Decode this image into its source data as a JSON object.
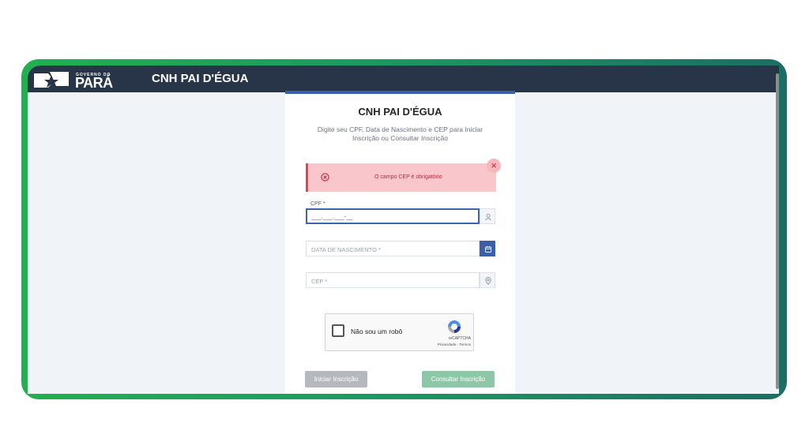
{
  "header": {
    "logo_small": "GOVERNO DO",
    "logo_big": "PARÁ",
    "title": "CNH PAI D'ÉGUA"
  },
  "card": {
    "title": "CNH PAI D'ÉGUA",
    "description": "Digite seu CPF, Data de Nascimento e CEP para Iniciar Inscrição ou Consultar Inscrição"
  },
  "alert": {
    "message": "O campo CEP é obrigatório",
    "close": "×"
  },
  "form": {
    "cpf_label": "CPF *",
    "cpf_value": "___.___.___-__",
    "birth_placeholder": "DATA DE NASCIMENTO *",
    "cep_placeholder": "CEP *"
  },
  "captcha": {
    "label": "Não sou um robô",
    "brand": "reCAPTCHA",
    "links": "Privacidade - Termos"
  },
  "buttons": {
    "start": "Iniciar Inscrição",
    "consult": "Consultar Inscrição"
  },
  "colors": {
    "frame_gradient_start": "#21b04f",
    "frame_gradient_end": "#1b6e63",
    "topbar": "#283548",
    "accent_blue": "#3b5fa9",
    "alert_bg": "#f9c6cb",
    "alert_text": "#c22530"
  },
  "icons": {
    "alert": "circle-x-icon",
    "cpf_addon": "user-icon",
    "birth_addon": "calendar-icon",
    "cep_addon": "map-pin-icon",
    "captcha": "recaptcha-icon",
    "logo": "star-flag-icon"
  }
}
